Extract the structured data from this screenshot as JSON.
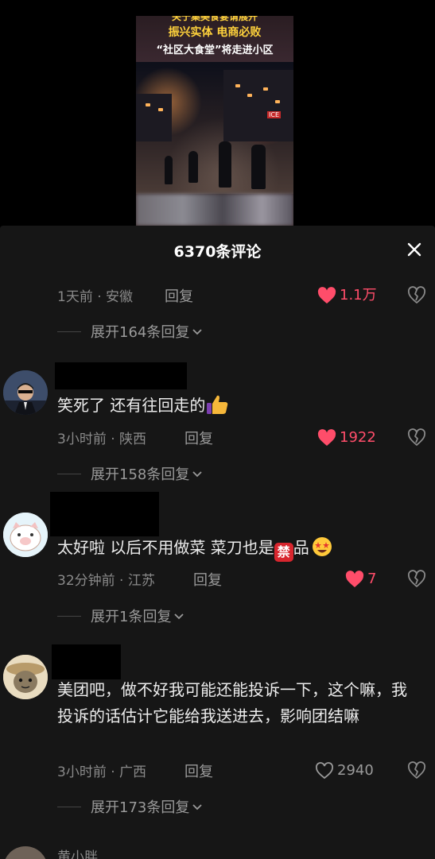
{
  "video": {
    "caption_lines": [
      "关于集美食宴请展开",
      "振兴实体  电商必败",
      "“社区大食堂”将走进小区"
    ]
  },
  "panel": {
    "title": "6370条评论"
  },
  "comments": [
    {
      "time_location": "1天前 · 安徽",
      "reply_label": "回复",
      "likes": "1.1万",
      "liked": true,
      "expand": "展开164条回复"
    },
    {
      "text": "笑死了 还有往回走的",
      "emoji": "thumbs-up",
      "time_location": "3小时前 · 陕西",
      "reply_label": "回复",
      "likes": "1922",
      "liked": true,
      "expand": "展开158条回复"
    },
    {
      "text_before": "太好啦 以后不用做菜 菜刀也是",
      "emoji_forbid": "禁",
      "text_after": "品",
      "emoji": "star-struck",
      "time_location": "32分钟前 · 江苏",
      "reply_label": "回复",
      "likes": "7",
      "liked": true,
      "expand": "展开1条回复"
    },
    {
      "text": "美团吧，做不好我可能还能投诉一下，这个嘛，我投诉的话估计它能给我送进去，影响团结嘛",
      "time_location": "3小时前 · 广西",
      "reply_label": "回复",
      "likes": "2940",
      "liked": false,
      "expand": "展开173条回复"
    }
  ],
  "partial_next_name": "黄小胖",
  "colors": {
    "panel_bg": "#161616",
    "like_red": "#ff4d6a",
    "muted": "#8a8a8a"
  }
}
